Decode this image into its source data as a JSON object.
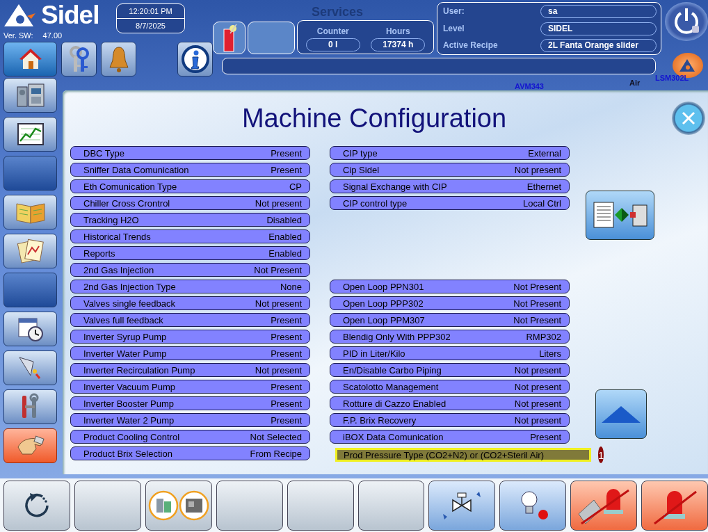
{
  "header": {
    "logo": "Sidel",
    "version_label": "Ver. SW:",
    "version": "47.00",
    "time": "12:20:01 PM",
    "date": "8/7/2025",
    "screen_title": "Services",
    "counter_label": "Counter",
    "counter": "0 l",
    "hours_label": "Hours",
    "hours": "17374 h",
    "user_fields": [
      {
        "label": "User:",
        "value": "sa"
      },
      {
        "label": "Level",
        "value": "SIDEL"
      },
      {
        "label": "Active Recipe",
        "value": "2L Fanta Orange slider"
      }
    ]
  },
  "toolbar": [
    {
      "kind": "keys"
    },
    {
      "kind": "bell"
    },
    {
      "kind": "info"
    }
  ],
  "background_labels": [
    "AVM343",
    "Air",
    "LSM302L"
  ],
  "sidebar": [
    {
      "kind": "machine",
      "selected": false
    },
    {
      "kind": "trend",
      "selected": false
    },
    {
      "kind": "blank",
      "selected": false
    },
    {
      "kind": "book",
      "selected": false
    },
    {
      "kind": "report",
      "selected": false
    },
    {
      "kind": "blank",
      "selected": false
    },
    {
      "kind": "calendar",
      "selected": false
    },
    {
      "kind": "lamp",
      "selected": false
    },
    {
      "kind": "tools",
      "selected": false
    },
    {
      "kind": "hand",
      "selected": true
    }
  ],
  "panel": {
    "title": "Machine Configuration",
    "left": [
      {
        "label": "DBC Type",
        "value": "Present"
      },
      {
        "label": "Sniffer Data Comunication",
        "value": "Present"
      },
      {
        "label": "Eth Comunication Type",
        "value": "CP"
      },
      {
        "label": "Chiller Cross Crontrol",
        "value": "Not present"
      },
      {
        "label": "Tracking H2O",
        "value": "Disabled"
      },
      {
        "label": "Historical Trends",
        "value": "Enabled"
      },
      {
        "label": "Reports",
        "value": "Enabled"
      },
      {
        "label": "2nd Gas Injection",
        "value": "Not Present"
      },
      {
        "label": "2nd Gas Injection Type",
        "value": "None"
      },
      {
        "label": "Valves single feedback",
        "value": "Not present"
      },
      {
        "label": "Valves full feedback",
        "value": "Present"
      },
      {
        "label": "Inverter Syrup Pump",
        "value": "Present"
      },
      {
        "label": "Inverter Water Pump",
        "value": "Present"
      },
      {
        "label": "Inverter Recirculation Pump",
        "value": "Not present"
      },
      {
        "label": "Inverter Vacuum Pump",
        "value": "Present"
      },
      {
        "label": "Inverter Booster Pump",
        "value": "Present"
      },
      {
        "label": "Inverter Water 2 Pump",
        "value": "Present"
      },
      {
        "label": "Product Cooling Control",
        "value": "Not Selected"
      },
      {
        "label": "Product Brix Selection",
        "value": "From Recipe"
      }
    ],
    "right_groups": [
      [
        {
          "label": "CIP type",
          "value": "External",
          "highlighted": false
        },
        {
          "label": "Cip Sidel",
          "value": "Not present",
          "highlighted": false
        },
        {
          "label": "Signal Exchange with CIP",
          "value": "Ethernet",
          "highlighted": false
        },
        {
          "label": "CIP control type",
          "value": "Local Ctrl",
          "highlighted": false
        }
      ],
      [
        {
          "label": "Open Loop PPN301",
          "value": "Not Present",
          "highlighted": false
        },
        {
          "label": "Open Loop PPP302",
          "value": "Not Present",
          "highlighted": false
        },
        {
          "label": "Open Loop PPM307",
          "value": "Not Present",
          "highlighted": false
        },
        {
          "label": "Blendig Only With PPP302",
          "value": "RMP302",
          "highlighted": false
        },
        {
          "label": "PID in Liter/Kilo",
          "value": "Liters",
          "highlighted": false
        },
        {
          "label": "En/Disable Carbo Piping",
          "value": "Not present",
          "highlighted": false
        },
        {
          "label": "Scatolotto Management",
          "value": "Not present",
          "highlighted": false
        },
        {
          "label": "Rotture di Cazzo Enabled",
          "value": "Not present",
          "highlighted": false
        },
        {
          "label": "F.P. Brix Recovery",
          "value": "Not present",
          "highlighted": false
        },
        {
          "label": "iBOX Data Comunication",
          "value": "Present",
          "highlighted": false
        },
        {
          "label": "Prod Pressure Type (CO2+N2) or (CO2+Steril Air)",
          "highlighted": true
        }
      ]
    ],
    "badge": "1"
  },
  "bottom_bar": [
    {
      "kind": "refresh"
    },
    {
      "kind": "blank"
    },
    {
      "kind": "tanks"
    },
    {
      "kind": "blank"
    },
    {
      "kind": "blank"
    },
    {
      "kind": "blank"
    },
    {
      "kind": "valve"
    },
    {
      "kind": "bulb"
    },
    {
      "kind": "alarm-off"
    },
    {
      "kind": "beacon-off"
    }
  ]
}
